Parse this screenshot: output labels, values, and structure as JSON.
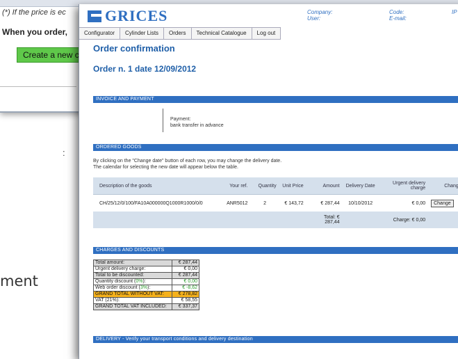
{
  "background_window": {
    "note": "(*) If the price is ec",
    "when_text": "When you order,",
    "create_button": "Create a new c"
  },
  "left_page": {
    "fragment1": ":",
    "fragment2": "ment"
  },
  "header": {
    "logo": "GRICES",
    "company_label": "Company:",
    "user_label": "User:",
    "code_label": "Code:",
    "email_label": "E-mail:",
    "ip_label": "IP A"
  },
  "nav": [
    "Configurator",
    "Cylinder Lists",
    "Orders",
    "Technical Catalogue",
    "Log out"
  ],
  "page_title": "Order confirmation",
  "order_line": "Order n. 1 date 12/09/2012",
  "sections": {
    "invoice": "INVOICE AND PAYMENT",
    "ordered": "ORDERED GOODS",
    "charges": "CHARGES AND DISCOUNTS",
    "delivery": "DELIVERY - Verify your transport conditions and delivery destination"
  },
  "payment": {
    "label": "Payment:",
    "method": "bank transfer in advance"
  },
  "ordered_info": [
    "By clicking on the \"Change date\" button of each row, you may change the delivery date.",
    "The calendar for selecting the new date will appear below the table."
  ],
  "goods_table": {
    "headers": [
      "Description of the goods",
      "Your ref.",
      "Quantity",
      "Unit Price",
      "Amount",
      "Delivery Date",
      "Urgent delivery charge",
      "Change del"
    ],
    "row": [
      "CH/25/12/0/100/FA10A000000Q1000R1000/0/0",
      "ANR5012",
      "2",
      "€ 143,72",
      "€ 287,44",
      "10/10/2012",
      "€ 0,00",
      "Change"
    ],
    "total_amount": "Total: € 287,44",
    "total_charge": "Charge: € 0,00"
  },
  "charges": {
    "total_amount": [
      "Total amount:",
      "€ 287,44"
    ],
    "urgent": [
      "Urgent delivery charge:",
      "€ 0,00"
    ],
    "to_discount": [
      "Total to be discounted:",
      "€ 287,44"
    ],
    "qty_discount_label": "Quantity discount (",
    "qty_discount_pct": "0%",
    "qty_discount_value": "€ 0,00",
    "web_discount_label": "Web order discount (",
    "web_discount_pct": "3%",
    "web_discount_value": "€ -8,62",
    "grand_no_vat": [
      "GRAND TOTAL WITHOUT VAT:",
      "€ 278,82"
    ],
    "vat": [
      "VAT (21%):",
      "€ 58,55"
    ],
    "grand_vat": [
      "GRAND TOTAL VAT INCLUDED:",
      "€ 337,37"
    ]
  },
  "colors": {
    "accent": "#2f6fc1",
    "title": "#1f5fa8",
    "create_button": "#5fc84a",
    "grand_total_highlight": "#f5b11c"
  }
}
